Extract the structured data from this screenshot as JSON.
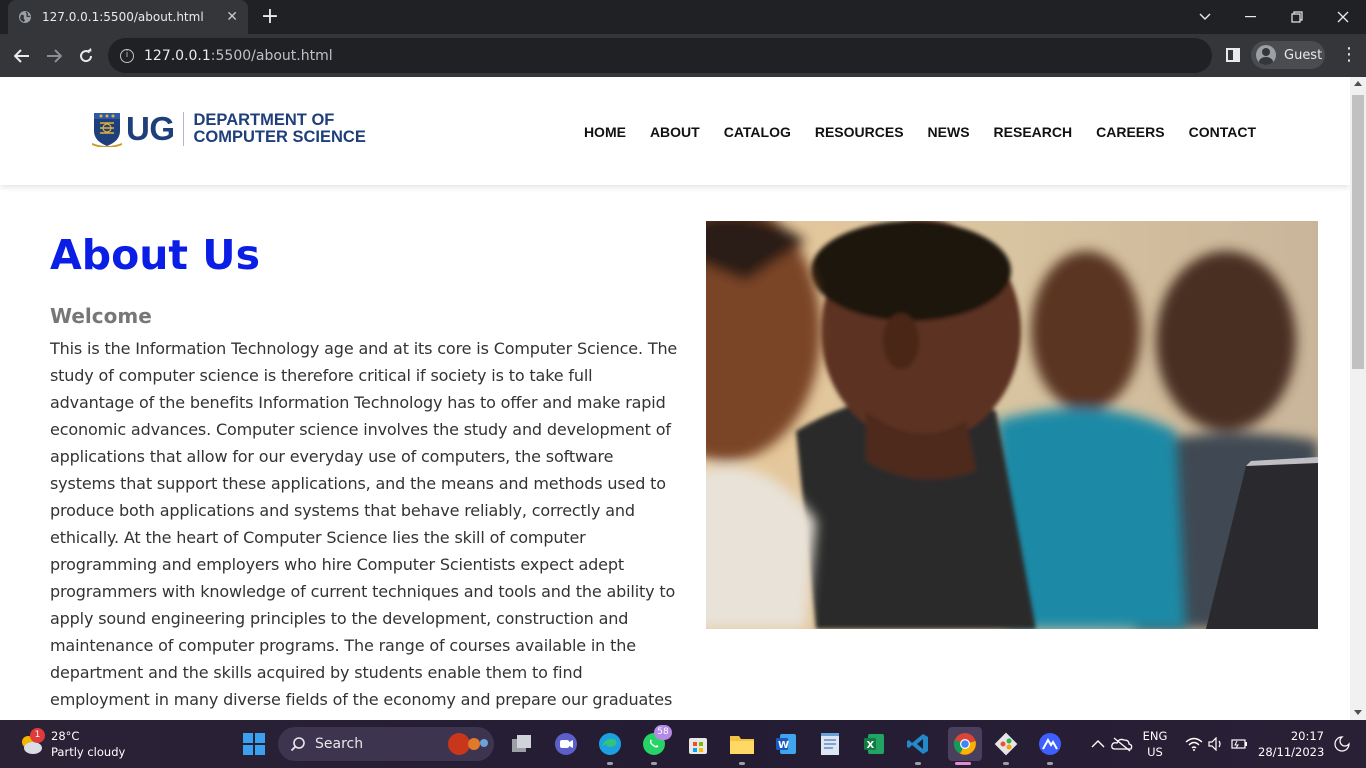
{
  "browser": {
    "tab_title": "127.0.0.1:5500/about.html",
    "url_host": "127.0.0.1",
    "url_rest": ":5500/about.html",
    "profile_name": "Guest"
  },
  "site": {
    "logo_ug": "UG",
    "logo_line1": "DEPARTMENT OF",
    "logo_line2": "COMPUTER SCIENCE",
    "nav": [
      "HOME",
      "ABOUT",
      "CATALOG",
      "RESOURCES",
      "NEWS",
      "RESEARCH",
      "CAREERS",
      "CONTACT"
    ]
  },
  "page": {
    "heading": "About Us",
    "subheading": "Welcome",
    "paragraph": "This is the Information Technology age and at its core is Computer Science. The study of computer science is therefore critical if society is to take full advantage of the benefits Information Technology has to offer and make rapid economic advances. Computer science involves the study and development of applications that allow for our everyday use of computers, the software systems that support these applications, and the means and methods used to produce both applications and systems that behave reliably, correctly and ethically. At the heart of Computer Science lies the skill of computer programming and employers who hire Computer Scientists expect adept programmers with knowledge of current techniques and tools and the ability to apply sound engineering principles to the development, construction and maintenance of computer programs. The range of courses available in the department and the skills acquired by students enable them to find employment in many diverse fields of the economy and prepare our graduates"
  },
  "taskbar": {
    "weather_temp": "28°C",
    "weather_desc": "Partly cloudy",
    "weather_badge": "1",
    "search_label": "Search",
    "whatsapp_badge": "58",
    "lang_line1": "ENG",
    "lang_line2": "US",
    "time": "20:17",
    "date": "28/11/2023"
  },
  "colors": {
    "heading": "#0a1ee6",
    "logo_blue": "#1f3f7a",
    "chrome_dark": "#202124",
    "chrome_toolbar": "#35363a"
  }
}
